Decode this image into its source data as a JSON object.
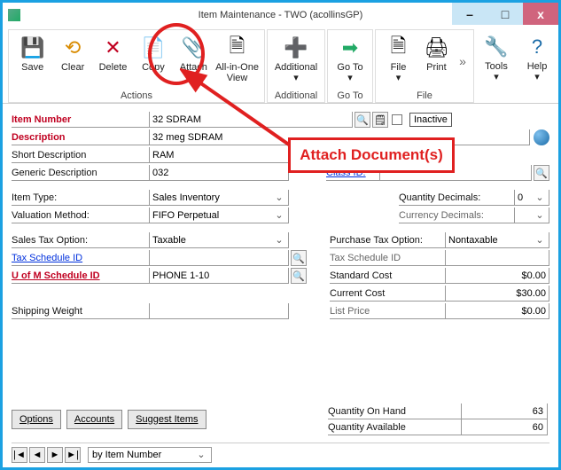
{
  "window": {
    "title": "Item Maintenance  -  TWO (acollinsGP)"
  },
  "ribbon": {
    "groups": {
      "actions": {
        "label": "Actions",
        "save": "Save",
        "clear": "Clear",
        "delete": "Delete",
        "copy": "Copy",
        "attach": "Attach",
        "allinone": "All-in-One View"
      },
      "additional": {
        "label": "Additional",
        "additional": "Additional"
      },
      "goto": {
        "label": "Go To",
        "goto": "Go To"
      },
      "file": {
        "label": "File",
        "file": "File",
        "print": "Print"
      },
      "tools": "Tools",
      "help": "Help"
    }
  },
  "labels": {
    "item_number": "Item Number",
    "description": "Description",
    "short_description": "Short Description",
    "generic_description": "Generic Description",
    "class_id": "Class ID:",
    "item_type": "Item Type:",
    "valuation_method": "Valuation Method:",
    "sales_tax_option": "Sales Tax Option:",
    "tax_schedule_id": "Tax Schedule ID",
    "uofm_schedule_id": "U of M Schedule ID",
    "shipping_weight": "Shipping Weight",
    "quantity_decimals": "Quantity Decimals:",
    "currency_decimals": "Currency Decimals:",
    "purchase_tax_option": "Purchase Tax Option:",
    "tax_schedule_id_r": "Tax Schedule ID",
    "standard_cost": "Standard Cost",
    "current_cost": "Current Cost",
    "list_price": "List Price",
    "inactive": "Inactive",
    "quantity_on_hand": "Quantity On Hand",
    "quantity_available": "Quantity Available"
  },
  "values": {
    "item_number": "32 SDRAM",
    "description": "32 meg SDRAM",
    "short_description": "RAM",
    "generic_description": "032",
    "class_id": "",
    "item_type": "Sales Inventory",
    "valuation_method": "FIFO Perpetual",
    "sales_tax_option": "Taxable",
    "tax_schedule_id": "",
    "uofm_schedule_id": "PHONE 1-10",
    "shipping_weight": "",
    "quantity_decimals": "0",
    "currency_decimals": "",
    "purchase_tax_option": "Nontaxable",
    "tax_schedule_id_r": "",
    "standard_cost": "$0.00",
    "current_cost": "$30.00",
    "list_price": "$0.00",
    "quantity_on_hand": "63",
    "quantity_available": "60"
  },
  "buttons": {
    "options": "Options",
    "accounts": "Accounts",
    "suggest_items": "Suggest Items"
  },
  "nav": {
    "sort_by": "by Item Number"
  },
  "annotation": {
    "callout": "Attach Document(s)"
  }
}
